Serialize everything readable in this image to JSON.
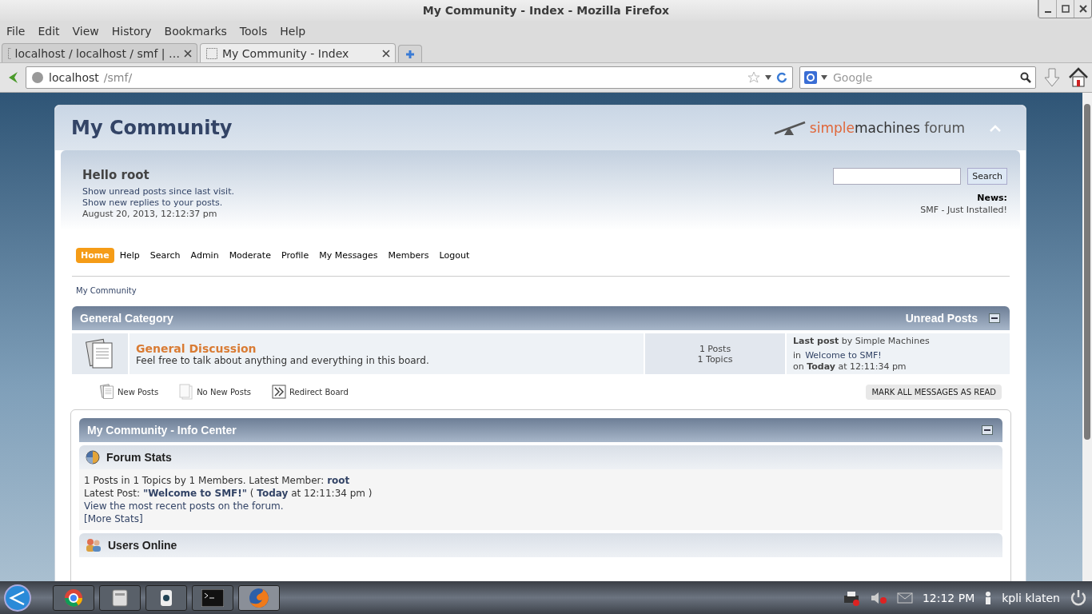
{
  "window": {
    "title": "My Community - Index - Mozilla Firefox"
  },
  "menu": [
    "File",
    "Edit",
    "View",
    "History",
    "Bookmarks",
    "Tools",
    "Help"
  ],
  "tabs": [
    {
      "label": "localhost / localhost / smf | …",
      "selected": false
    },
    {
      "label": "My Community - Index",
      "selected": true
    }
  ],
  "address": {
    "host": "localhost",
    "path": "/smf/"
  },
  "search_engine": {
    "placeholder": "Google"
  },
  "forum": {
    "title": "My Community",
    "logo": {
      "part_1": "simple",
      "part_2": "machines",
      "part_3": "forum"
    },
    "greeting": "Hello root",
    "user_links": [
      "Show unread posts since last visit.",
      "Show new replies to your posts."
    ],
    "date": "August 20, 2013, 12:12:37 pm",
    "search_button": "Search",
    "news_label": "News:",
    "news": "SMF - Just Installed!",
    "nav": [
      {
        "label": "Home",
        "selected": true
      },
      {
        "label": "Help",
        "selected": false
      },
      {
        "label": "Search",
        "selected": false
      },
      {
        "label": "Admin",
        "selected": false
      },
      {
        "label": "Moderate",
        "selected": false
      },
      {
        "label": "Profile",
        "selected": false
      },
      {
        "label": "My Messages",
        "selected": false
      },
      {
        "label": "Members",
        "selected": false
      },
      {
        "label": "Logout",
        "selected": false
      }
    ],
    "breadcrumb": "My Community",
    "category": {
      "title": "General Category",
      "unread_link": "Unread Posts",
      "boards": [
        {
          "name": "General Discussion",
          "description": "Feel free to talk about anything and everything in this board.",
          "posts": "1 Posts",
          "topics": "1 Topics",
          "last_post": "**Last post** by Simple Machines",
          "last_topic_prefix": "in",
          "last_topic": "Welcome to SMF!",
          "last_time": "on **Today** at 12:11:34 pm"
        }
      ]
    },
    "legend": [
      {
        "kind": "new",
        "label": "New Posts"
      },
      {
        "kind": "none",
        "label": "No New Posts"
      },
      {
        "kind": "redirect",
        "label": "Redirect Board"
      }
    ],
    "mark_read_button": "MARK ALL MESSAGES AS READ",
    "info_center": {
      "title": "My Community - Info Center",
      "sections": [
        {
          "kind": "stats",
          "title": "Forum Stats",
          "lines": [
            "1 Posts in 1 Topics by 1 Members. Latest Member: **root**",
            "Latest Post: **\"Welcome to SMF!\"** ( **Today** at 12:11:34 pm )",
            "View the most recent posts on the forum.",
            "[More Stats]"
          ]
        },
        {
          "kind": "users",
          "title": "Users Online"
        }
      ]
    }
  },
  "taskbar": {
    "clock": "12:12 PM",
    "user": "kpli klaten"
  }
}
